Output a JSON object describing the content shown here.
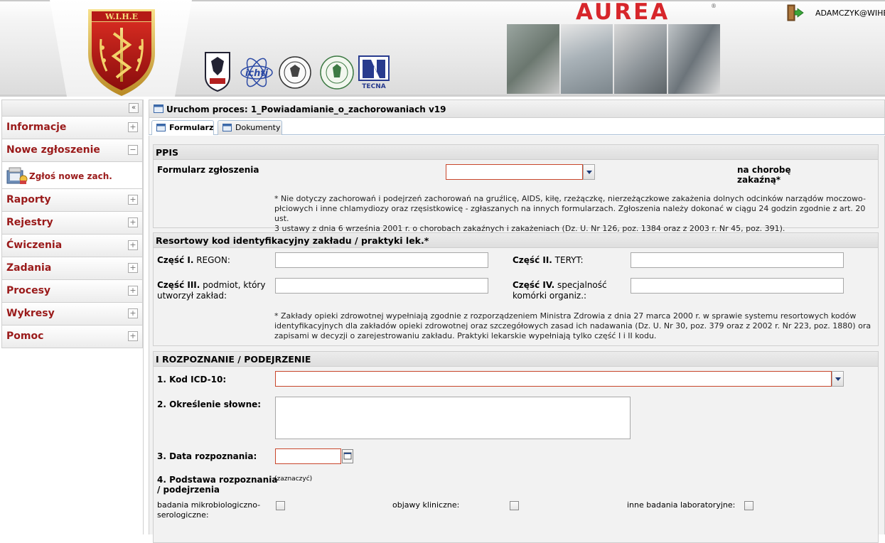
{
  "header": {
    "shield_text": "W.I.H.E",
    "brand": "AUREA",
    "registered_mark": "®",
    "username": "ADAMCZYK@WIHE",
    "logos": [
      "wihe-eagle-logo",
      "ichtj-logo",
      "seal-logo-1",
      "seal-logo-2",
      "tecna-logo"
    ],
    "tecna_text": "TECNA",
    "ichtj_text": "ichtj"
  },
  "sidebar": {
    "collapse_label": "«",
    "items": [
      {
        "label": "Informacje",
        "toggle": "+"
      },
      {
        "label": "Nowe zgłoszenie",
        "toggle": "−"
      },
      {
        "label": "Raporty",
        "toggle": "+"
      },
      {
        "label": "Rejestry",
        "toggle": "+"
      },
      {
        "label": "Ćwiczenia",
        "toggle": "+"
      },
      {
        "label": "Zadania",
        "toggle": "+"
      },
      {
        "label": "Procesy",
        "toggle": "+"
      },
      {
        "label": "Wykresy",
        "toggle": "+"
      },
      {
        "label": "Pomoc",
        "toggle": "+"
      }
    ],
    "subitem": "Zgłoś nowe zach."
  },
  "main": {
    "title": "Uruchom proces: 1_Powiadamianie_o_zachorowaniach v19",
    "tabs": [
      {
        "label": "Formularz",
        "active": true
      },
      {
        "label": "Dokumenty",
        "active": false
      }
    ]
  },
  "form": {
    "ppis": {
      "header": "PPIS",
      "label": "Formularz zgłoszenia",
      "select_value": "",
      "suffix_line1": "na chorobę",
      "suffix_line2": "zakaźną*",
      "note_lines": [
        "* Nie dotyczy zachorowań i podejrzeń zachorowań na gruźlicę, AIDS, kiłę, rzeżączkę, nierzeżączkowe zakażenia dolnych odcinków narządów moczowo-",
        "płciowych i inne chlamydiozy oraz rzęsistkowicę - zgłaszanych na innych formularzach. Zgłoszenia należy dokonać w ciągu 24 godzin zgodnie z art. 20 ust.",
        "3 ustawy z dnia 6 września 2001 r. o chorobach zakaźnych i zakażeniach (Dz. U. Nr 126, poz. 1384 oraz z 2003 r. Nr 45, poz. 391)."
      ]
    },
    "resort": {
      "header": "Resortowy kod identyfikacyjny zakładu / praktyki lek.*",
      "part1_bold": "Część I.",
      "part1_text": " REGON:",
      "part2_bold": "Część II.",
      "part2_text": " TERYT:",
      "part3_bold": "Część III.",
      "part3_text_a": " podmiot, który",
      "part3_text_b": "utworzył zakład:",
      "part4_bold": "Część IV.",
      "part4_text_a": " specjalność",
      "part4_text_b": "komórki organiz.:",
      "regon": "",
      "teryt": "",
      "podmiot": "",
      "specjalnosc": "",
      "note_lines": [
        "* Zakłady opieki zdrowotnej wypełniają zgodnie z rozporządzeniem Ministra Zdrowia z dnia 27 marca 2000 r. w sprawie systemu resortowych kodów",
        "identyfikacyjnych dla zakładów opieki zdrowotnej oraz szczegółowych zasad ich nadawania (Dz. U. Nr 30, poz. 379 oraz z 2002 r. Nr 223, poz. 1880) ora",
        "zapisami w decyzji o zarejestrowaniu zakładu. Praktyki lekarskie wypełniają tylko część I i II kodu."
      ]
    },
    "diag": {
      "header": "I ROZPOZNANIE / PODEJRZENIE",
      "icd_label": "1. Kod ICD-10:",
      "icd_value": "",
      "okreslenie_label": "2. Określenie słowne:",
      "okreslenie_value": "",
      "data_label": "3. Data rozpoznania:",
      "data_value": "",
      "podstawa_label_a": "4. Podstawa rozpoznania",
      "podstawa_label_b": "/ podejrzenia",
      "podstawa_hint": "(zaznaczyć)",
      "cb1_label_a": "badania mikrobiologiczno-",
      "cb1_label_b": "serologiczne:",
      "cb2_label": "objawy kliniczne:",
      "cb3_label": "inne badania laboratoryjne:"
    }
  },
  "colors": {
    "nav_text": "#9a1a1a",
    "error_border": "#c8462b",
    "brand_red": "#d7262b",
    "tab_border": "#a9bfd6"
  }
}
